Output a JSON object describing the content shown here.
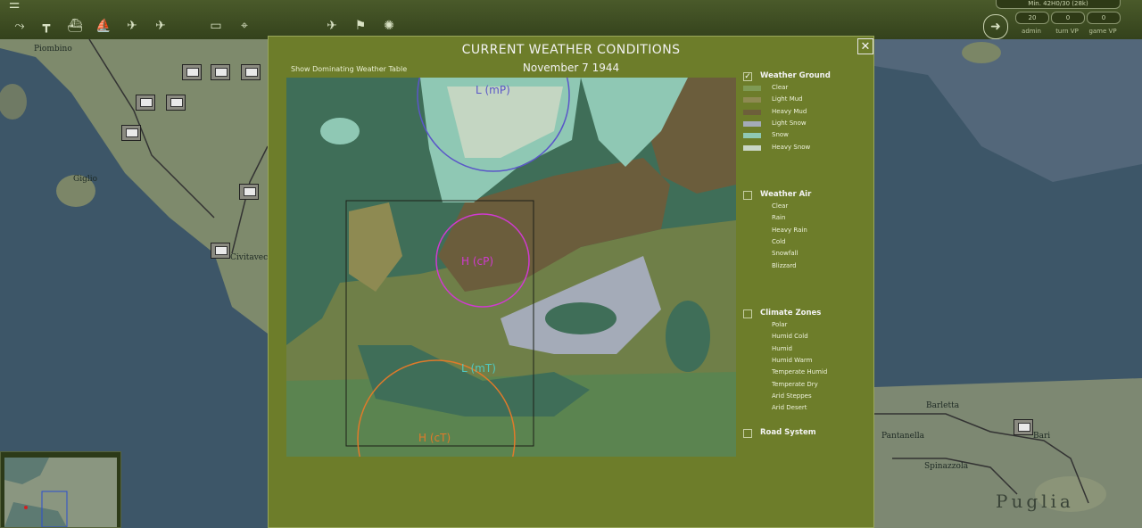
{
  "dialog": {
    "title": "CURRENT WEATHER CONDITIONS",
    "date": "November  7  1944",
    "show_table_link": "Show Dominating Weather Table",
    "close_glyph": "✕",
    "map_labels": {
      "low_north": "L (mP)",
      "high_center": "H (cP)",
      "low_south": "L (mT)",
      "high_south": "H (cT)"
    }
  },
  "legend": {
    "weather_ground": {
      "title": "Weather Ground",
      "checked": true,
      "items": [
        {
          "label": "Clear",
          "color": "#7f9a55"
        },
        {
          "label": "Light Mud",
          "color": "#8e8a52"
        },
        {
          "label": "Heavy Mud",
          "color": "#6d5f3a"
        },
        {
          "label": "Light Snow",
          "color": "#a4abb8"
        },
        {
          "label": "Snow",
          "color": "#8fc8b4"
        },
        {
          "label": "Heavy Snow",
          "color": "#c9d6c5"
        }
      ]
    },
    "weather_air": {
      "title": "Weather Air",
      "checked": false,
      "items": [
        "Clear",
        "Rain",
        "Heavy Rain",
        "Cold",
        "Snowfall",
        "Blizzard"
      ]
    },
    "climate_zones": {
      "title": "Climate Zones",
      "checked": false,
      "items": [
        "Polar",
        "Humid Cold",
        "Humid",
        "Humid Warm",
        "Temperate Humid",
        "Temperate Dry",
        "Arid Steppes",
        "Arid Desert"
      ]
    },
    "road_system": {
      "title": "Road System",
      "checked": false
    }
  },
  "top_bar": {
    "stats_line": "Min. 42H0/30 (28k)",
    "stats": [
      {
        "value": "20",
        "label": "admin"
      },
      {
        "value": "0",
        "label": "turn VP"
      },
      {
        "value": "0",
        "label": "game VP"
      }
    ]
  },
  "background_map": {
    "labels": [
      "Piombino",
      "Giglio",
      "Civitavecc",
      "Barletta",
      "Pantanella",
      "Bari",
      "Spinazzola",
      "Puglia"
    ]
  },
  "icons": {
    "menu": "menu-icon",
    "close": "close-icon",
    "end_turn": "end-turn-icon"
  },
  "colors": {
    "dialog_bg": "#6d7d2a",
    "sea": "#3f6f5a",
    "toolbar": "#3e4c22"
  }
}
